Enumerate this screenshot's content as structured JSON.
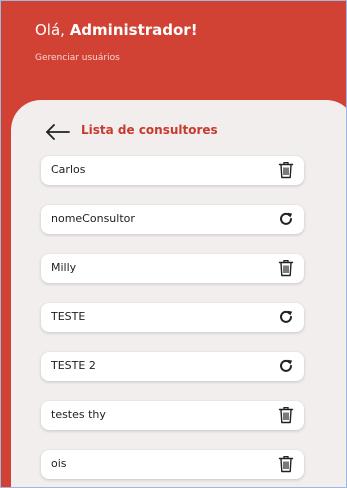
{
  "header": {
    "greeting_prefix": "Olá, ",
    "greeting_name": "Administrador!",
    "subtitle": "Gerenciar usuários"
  },
  "list": {
    "title": "Lista de consultores",
    "back_icon": "arrow-left-icon",
    "items": [
      {
        "name": "Carlos",
        "action_icon": "trash-icon"
      },
      {
        "name": "nomeConsultor",
        "action_icon": "refresh-icon"
      },
      {
        "name": "Milly",
        "action_icon": "trash-icon"
      },
      {
        "name": "TESTE",
        "action_icon": "refresh-icon"
      },
      {
        "name": "TESTE 2",
        "action_icon": "refresh-icon"
      },
      {
        "name": "testes thy",
        "action_icon": "trash-icon"
      },
      {
        "name": "ois",
        "action_icon": "trash-icon"
      }
    ]
  },
  "colors": {
    "brand_red": "#d24234",
    "title_red": "#c83a2d",
    "panel_bg": "#f2eeee"
  }
}
